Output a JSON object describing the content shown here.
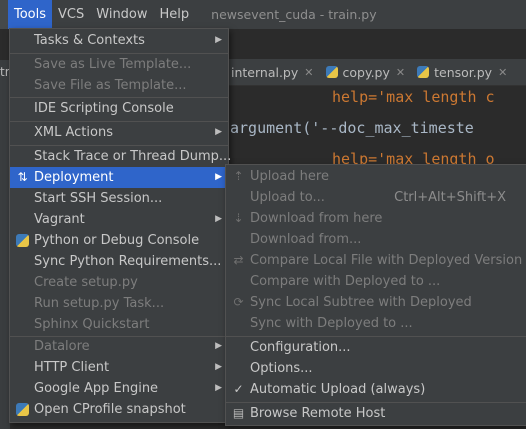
{
  "menubar": {
    "items": [
      "Tools",
      "VCS",
      "Window",
      "Help"
    ],
    "window_title": "newsevent_cuda - train.py",
    "left_fragment": "s"
  },
  "tabs": [
    "internal.py",
    "copy.py",
    "tensor.py"
  ],
  "left_tab_fragment": "tr",
  "code_lines": [
    {
      "text": "help='max length c",
      "color": "#cc7832"
    },
    {
      "text": "argument('--doc_max_timeste",
      "color": "#a9b7c6"
    },
    {
      "text": "help='max length o",
      "color": "#cc7832"
    }
  ],
  "tools_menu": {
    "items": [
      {
        "label": "Tasks & Contexts",
        "submenu": true,
        "disabled": false
      },
      {
        "label": "Save as Live Template...",
        "disabled": true
      },
      {
        "label": "Save File as Template...",
        "disabled": true
      },
      {
        "label": "IDE Scripting Console",
        "disabled": false
      },
      {
        "label": "XML Actions",
        "submenu": true,
        "disabled": false
      },
      {
        "label": "Stack Trace or Thread Dump...",
        "disabled": false
      },
      {
        "label": "Deployment",
        "submenu": true,
        "selected": true,
        "icon": "sync-arrows-icon"
      },
      {
        "label": "Start SSH Session...",
        "disabled": false
      },
      {
        "label": "Vagrant",
        "submenu": true,
        "disabled": false
      },
      {
        "label": "Python or Debug Console",
        "icon": "python-icon",
        "disabled": false
      },
      {
        "label": "Sync Python Requirements...",
        "disabled": false
      },
      {
        "label": "Create setup.py",
        "disabled": true
      },
      {
        "label": "Run setup.py Task...",
        "disabled": true
      },
      {
        "label": "Sphinx Quickstart",
        "disabled": true
      },
      {
        "label": "Datalore",
        "submenu": true,
        "disabled": true
      },
      {
        "label": "HTTP Client",
        "submenu": true,
        "disabled": false
      },
      {
        "label": "Google App Engine",
        "submenu": true,
        "disabled": false
      },
      {
        "label": "Open CProfile snapshot",
        "icon": "python-profile-icon",
        "disabled": false
      }
    ]
  },
  "deploy_menu": {
    "items": [
      {
        "label": "Upload here",
        "disabled": true,
        "icon": "upload-icon"
      },
      {
        "label": "Upload to...",
        "disabled": true,
        "shortcut": "Ctrl+Alt+Shift+X"
      },
      {
        "label": "Download from here",
        "disabled": true,
        "icon": "download-icon"
      },
      {
        "label": "Download from...",
        "disabled": true
      },
      {
        "label": "Compare Local File with Deployed Version",
        "disabled": true,
        "icon": "compare-icon"
      },
      {
        "label": "Compare with Deployed to ...",
        "disabled": true
      },
      {
        "label": "Sync Local Subtree with Deployed",
        "disabled": true,
        "icon": "sync-icon"
      },
      {
        "label": "Sync with Deployed to ...",
        "disabled": true
      },
      {
        "label": "Configuration...",
        "disabled": false
      },
      {
        "label": "Options...",
        "disabled": false
      },
      {
        "label": "Automatic Upload (always)",
        "disabled": false,
        "checked": true
      },
      {
        "label": "Browse Remote Host",
        "disabled": false,
        "icon": "remote-host-icon"
      }
    ]
  }
}
